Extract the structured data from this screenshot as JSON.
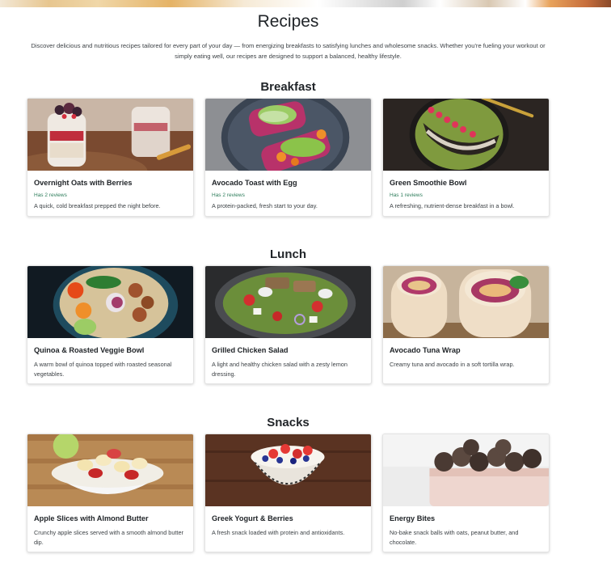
{
  "page": {
    "title": "Recipes",
    "intro": "Discover delicious and nutritious recipes tailored for every part of your day — from energizing breakfasts to satisfying lunches and wholesome snacks. Whether you're fueling your workout or simply eating well, our recipes are designed to support a balanced, healthy lifestyle."
  },
  "sections": [
    {
      "title": "Breakfast",
      "cards": [
        {
          "title": "Overnight Oats with Berries",
          "reviews": "Has 2 reviews",
          "desc": "A quick, cold breakfast prepped the night before."
        },
        {
          "title": "Avocado Toast with Egg",
          "reviews": "Has 2 reviews",
          "desc": "A protein-packed, fresh start to your day."
        },
        {
          "title": "Green Smoothie Bowl",
          "reviews": "Has 1 reviews",
          "desc": "A refreshing, nutrient-dense breakfast in a bowl."
        }
      ]
    },
    {
      "title": "Lunch",
      "cards": [
        {
          "title": "Quinoa & Roasted Veggie Bowl",
          "desc": "A warm bowl of quinoa topped with roasted seasonal vegetables."
        },
        {
          "title": "Grilled Chicken Salad",
          "desc": "A light and healthy chicken salad with a zesty lemon dressing."
        },
        {
          "title": "Avocado Tuna Wrap",
          "desc": "Creamy tuna and avocado in a soft tortilla wrap."
        }
      ]
    },
    {
      "title": "Snacks",
      "cards": [
        {
          "title": "Apple Slices with Almond Butter",
          "desc": "Crunchy apple slices served with a smooth almond butter dip."
        },
        {
          "title": "Greek Yogurt & Berries",
          "desc": "A fresh snack loaded with protein and antioxidants."
        },
        {
          "title": "Energy Bites",
          "desc": "No-bake snack balls with oats, peanut butter, and chocolate."
        }
      ]
    }
  ],
  "colors": {
    "review_green": "#2e7d5b",
    "text": "#212529",
    "muted": "#3d4246"
  }
}
